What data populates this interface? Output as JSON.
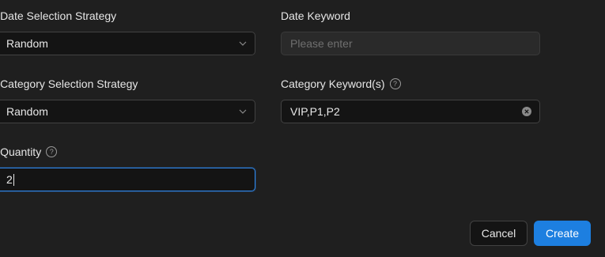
{
  "form": {
    "date_strategy": {
      "required_mark": "*",
      "label": "Date Selection Strategy",
      "value": "Random"
    },
    "date_keyword": {
      "label": "Date Keyword",
      "placeholder": "Please enter"
    },
    "category_strategy": {
      "required_mark": "*",
      "label": "Category Selection Strategy",
      "value": "Random"
    },
    "category_keywords": {
      "label": "Category Keyword(s)",
      "help_glyph": "?",
      "value": "VIP,P1,P2"
    },
    "quantity": {
      "required_mark": "*",
      "label": "Quantity",
      "help_glyph": "?",
      "value": "2"
    }
  },
  "footer": {
    "cancel_label": "Cancel",
    "create_label": "Create"
  },
  "colors": {
    "background": "#1f1f1f",
    "field_bg": "#141414",
    "primary": "#1d7fe0",
    "focus_border": "#2e85e6",
    "required": "#d9534f"
  },
  "icons": {
    "select_arrow": "chevron-down-icon",
    "clear": "clear-circle-icon",
    "help": "question-circle-icon"
  }
}
